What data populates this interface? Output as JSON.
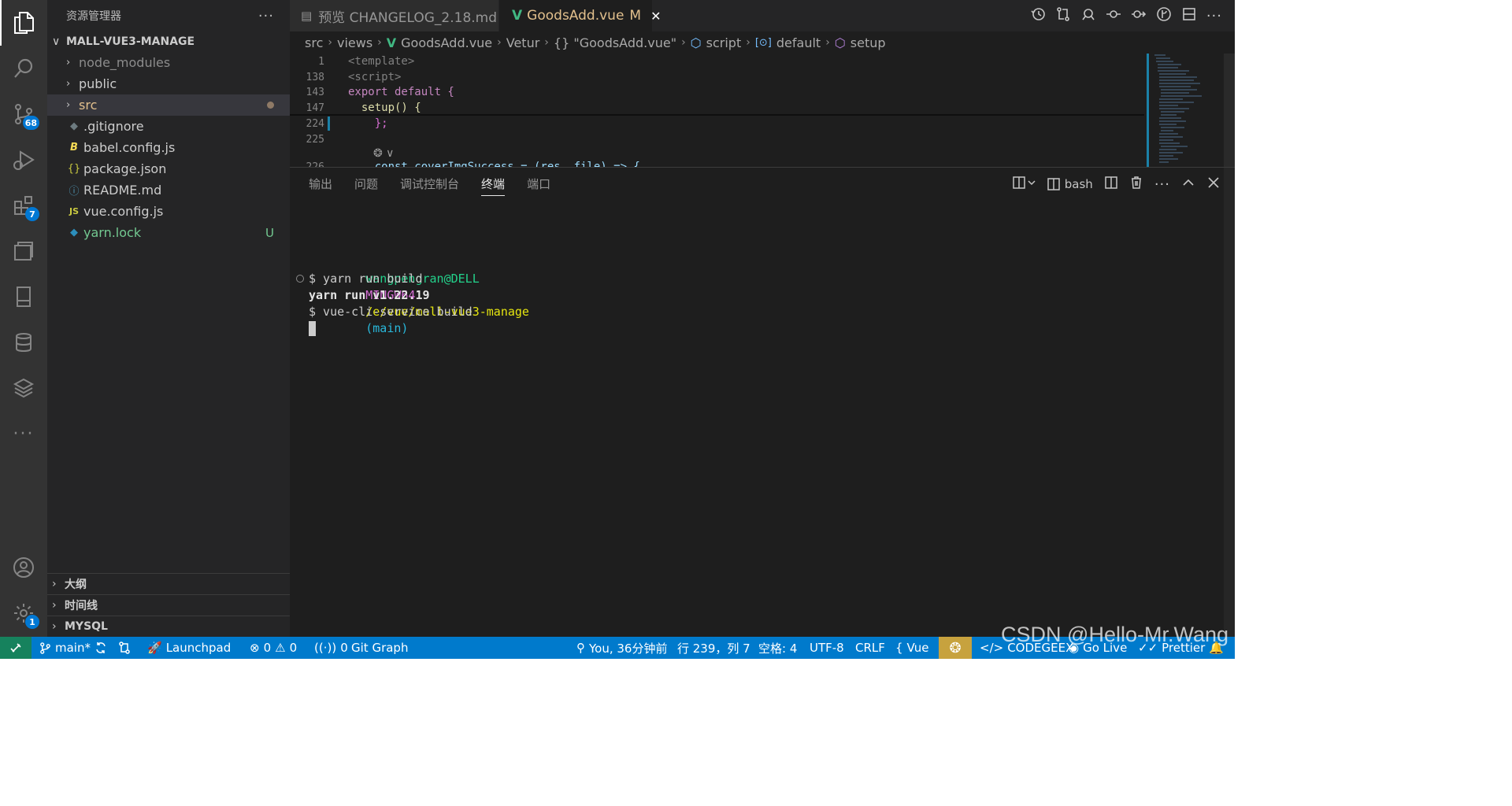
{
  "activity_bar": {
    "items": [
      {
        "icon": "explorer-icon"
      },
      {
        "icon": "search-icon"
      },
      {
        "icon": "source-control-icon",
        "badge": "68"
      },
      {
        "icon": "run-debug-icon"
      },
      {
        "icon": "extensions-icon",
        "badge": "7"
      },
      {
        "icon": "remote-explorer-icon"
      },
      {
        "icon": "bookmark-icon"
      },
      {
        "icon": "database-icon"
      },
      {
        "icon": "layers-icon"
      },
      {
        "icon": "more-icon"
      }
    ],
    "account_icon": "account-icon",
    "settings_badge": "1"
  },
  "sidebar": {
    "title": "资源管理器",
    "more": "···",
    "root": "MALL-VUE3-MANAGE",
    "items": [
      {
        "label": "node_modules",
        "kind": "folder",
        "color": "#8c8c8c"
      },
      {
        "label": "public",
        "kind": "folder",
        "color": "#cccccc"
      },
      {
        "label": "src",
        "kind": "folder",
        "color": "#e2c08d"
      },
      {
        "label": ".gitignore",
        "kind": "file",
        "icon": "◆",
        "icon_color": "#41535b",
        "color": "#cccccc"
      },
      {
        "label": "babel.config.js",
        "kind": "file",
        "icon": "B",
        "icon_color": "#f5da55",
        "color": "#cccccc"
      },
      {
        "label": "package.json",
        "kind": "file",
        "icon": "{}",
        "icon_color": "#cbcb41",
        "color": "#cccccc"
      },
      {
        "label": "README.md",
        "kind": "file",
        "icon": "ⓘ",
        "icon_color": "#519aba",
        "color": "#cccccc"
      },
      {
        "label": "vue.config.js",
        "kind": "file",
        "icon": "JS",
        "icon_color": "#cbcb41",
        "color": "#cccccc"
      },
      {
        "label": "yarn.lock",
        "kind": "file",
        "icon": "◆",
        "icon_color": "#2c8ebb",
        "color": "#73c991",
        "badge": "U"
      }
    ],
    "sections": [
      "大纲",
      "时间线",
      "MYSQL"
    ]
  },
  "tabs": [
    {
      "label": "预览 CHANGELOG_2.18.md"
    },
    {
      "label": "GoodsAdd.vue",
      "modified": "M",
      "close": "✕"
    }
  ],
  "breadcrumb": [
    "src",
    "views",
    "GoodsAdd.vue",
    "Vetur",
    "{} \"GoodsAdd.vue\"",
    "script",
    "default",
    "setup"
  ],
  "editor": {
    "lines": [
      {
        "num": "1",
        "text": "<template>"
      },
      {
        "num": "138",
        "text": "<script>"
      },
      {
        "num": "143",
        "text": "export default {"
      },
      {
        "num": "147",
        "text": "  setup() {"
      },
      {
        "num": "224",
        "text": "    };"
      },
      {
        "num": "225",
        "text": ""
      },
      {
        "num": "226",
        "text": "    const coverImgSuccess = (res, file) => {"
      }
    ]
  },
  "panel": {
    "tabs": [
      "输出",
      "问题",
      "调试控制台",
      "终端",
      "端口"
    ],
    "active_tab": "终端",
    "shell": "bash",
    "terminal": {
      "prompt_user": "wangpengran@DELL",
      "prompt_env": "MINGW64",
      "prompt_path": "/e/vue/mall-vue3-manage",
      "prompt_branch": "(main)",
      "lines": [
        "$ yarn run build",
        "yarn run v1.22.19",
        "$ vue-cli-service build"
      ]
    }
  },
  "status_bar": {
    "branch": "main*",
    "launchpad": "Launchpad",
    "errors": "0",
    "warnings": "0",
    "ports": "0",
    "git_graph": "Git Graph",
    "blame": "You, 36分钟前",
    "position": "行 239，列 7",
    "spaces": "空格: 4",
    "encoding": "UTF-8",
    "eol": "CRLF",
    "language": "Vue",
    "codegeex": "CODEGEEX",
    "golive": "Go Live",
    "prettier": "Prettier"
  },
  "watermark": "CSDN @Hello-Mr.Wang"
}
